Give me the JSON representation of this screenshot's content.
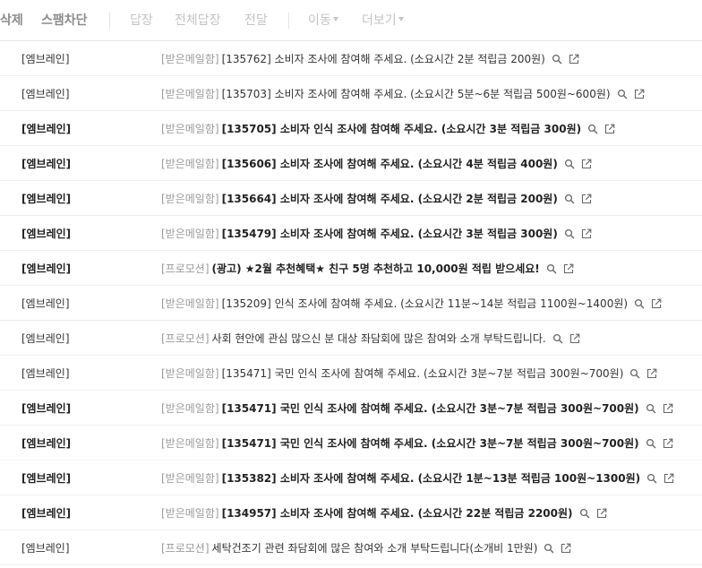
{
  "toolbar": {
    "delete_label": "삭제",
    "spam_label": "스팸차단",
    "reply_label": "답장",
    "reply_all_label": "전체답장",
    "forward_label": "전달",
    "move_label": "이동",
    "more_label": "더보기"
  },
  "mails": [
    {
      "sender": "[엠브레인]",
      "prefix": "[받은메일함]",
      "subject": "[135762] 소비자 조사에 참여해 주세요. (소요시간 2분 적립금 200원)",
      "unread": false
    },
    {
      "sender": "[엠브레인]",
      "prefix": "[받은메일함]",
      "subject": "[135703] 소비자 조사에 참여해 주세요. (소요시간 5분~6분 적립금 500원~600원)",
      "unread": false
    },
    {
      "sender": "[엠브레인]",
      "prefix": "[받은메일함]",
      "subject": "[135705] 소비자 인식 조사에 참여해 주세요. (소요시간 3분 적립금 300원)",
      "unread": true
    },
    {
      "sender": "[엠브레인]",
      "prefix": "[받은메일함]",
      "subject": "[135606] 소비자 조사에 참여해 주세요. (소요시간 4분 적립금 400원)",
      "unread": true
    },
    {
      "sender": "[엠브레인]",
      "prefix": "[받은메일함]",
      "subject": "[135664] 소비자 조사에 참여해 주세요. (소요시간 2분 적립금 200원)",
      "unread": true
    },
    {
      "sender": "[엠브레인]",
      "prefix": "[받은메일함]",
      "subject": "[135479] 소비자 조사에 참여해 주세요. (소요시간 3분 적립금 300원)",
      "unread": true
    },
    {
      "sender": "[엠브레인]",
      "prefix": "[프로모션]",
      "subject": "(광고) ★2월 추천혜택★ 친구 5명 추천하고 10,000원 적립 받으세요!",
      "unread": true
    },
    {
      "sender": "[엠브레인]",
      "prefix": "[받은메일함]",
      "subject": "[135209] 인식 조사에 참여해 주세요. (소요시간 11분~14분 적립금 1100원~1400원)",
      "unread": false
    },
    {
      "sender": "[엠브레인]",
      "prefix": "[프로모션]",
      "subject": "사회 현안에 관심 많으신 분 대상 좌담회에 많은 참여와 소개 부탁드립니다.",
      "unread": false
    },
    {
      "sender": "[엠브레인]",
      "prefix": "[받은메일함]",
      "subject": "[135471] 국민 인식 조사에 참여해 주세요. (소요시간 3분~7분 적립금 300원~700원)",
      "unread": false
    },
    {
      "sender": "[엠브레인]",
      "prefix": "[받은메일함]",
      "subject": "[135471] 국민 인식 조사에 참여해 주세요. (소요시간 3분~7분 적립금 300원~700원)",
      "unread": true
    },
    {
      "sender": "[엠브레인]",
      "prefix": "[받은메일함]",
      "subject": "[135471] 국민 인식 조사에 참여해 주세요. (소요시간 3분~7분 적립금 300원~700원)",
      "unread": true
    },
    {
      "sender": "[엠브레인]",
      "prefix": "[받은메일함]",
      "subject": "[135382] 소비자 조사에 참여해 주세요. (소요시간 1분~13분 적립금 100원~1300원)",
      "unread": true
    },
    {
      "sender": "[엠브레인]",
      "prefix": "[받은메일함]",
      "subject": "[134957] 소비자 조사에 참여해 주세요. (소요시간 22분 적립금 2200원)",
      "unread": true
    },
    {
      "sender": "[엠브레인]",
      "prefix": "[프로모션]",
      "subject": "세탁건조기 관련 좌담회에 많은 참여와 소개 부탁드립니다(소개비 1만원)",
      "unread": false
    }
  ],
  "icons": {
    "preview": "search-icon",
    "open_new": "open-new-window-icon"
  }
}
